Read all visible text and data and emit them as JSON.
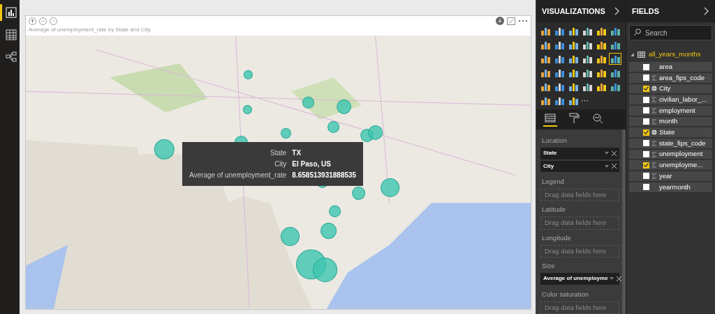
{
  "nav": [
    {
      "selected": true
    },
    {
      "selected": false
    },
    {
      "selected": false
    }
  ],
  "visual": {
    "title": "Average of unemployment_rate by State and City",
    "tooltip": [
      {
        "label": "State",
        "value": "TX"
      },
      {
        "label": "City",
        "value": "El Paso, US"
      },
      {
        "label": "Average of unemployment_rate",
        "value": "8.658513931888535"
      }
    ]
  },
  "visualizations": {
    "title": "VISUALIZATIONS",
    "types": [
      {
        "selected": false
      },
      {
        "selected": false
      },
      {
        "selected": false
      },
      {
        "selected": false
      },
      {
        "selected": false
      },
      {
        "selected": false
      },
      {
        "selected": false
      },
      {
        "selected": false
      },
      {
        "selected": false
      },
      {
        "selected": false
      },
      {
        "selected": false
      },
      {
        "selected": false
      },
      {
        "selected": false
      },
      {
        "selected": false
      },
      {
        "selected": false
      },
      {
        "selected": false
      },
      {
        "selected": false
      },
      {
        "selected": true
      },
      {
        "selected": false
      },
      {
        "selected": false
      },
      {
        "selected": false
      },
      {
        "selected": false
      },
      {
        "selected": false
      },
      {
        "selected": false
      },
      {
        "selected": false
      },
      {
        "selected": false
      },
      {
        "selected": false
      },
      {
        "selected": false
      },
      {
        "selected": false
      },
      {
        "selected": false
      },
      {
        "selected": false
      },
      {
        "selected": false
      },
      {
        "selected": false
      }
    ],
    "more": "···",
    "pane_tabs": [
      {
        "selected": true
      },
      {
        "selected": false
      },
      {
        "selected": false
      }
    ],
    "wells": [
      {
        "label": "Location",
        "fields": [
          "State",
          "City"
        ]
      },
      {
        "label": "Legend",
        "placeholder": "Drag data fields here"
      },
      {
        "label": "Latitude",
        "placeholder": "Drag data fields here"
      },
      {
        "label": "Longitude",
        "placeholder": "Drag data fields here"
      },
      {
        "label": "Size",
        "fields": [
          "Average of unemployme"
        ]
      },
      {
        "label": "Color saturation",
        "placeholder": "Drag data fields here"
      }
    ]
  },
  "fields": {
    "title": "FIELDS",
    "search": {
      "placeholder": "Search"
    },
    "table": "all_years_months",
    "items": [
      {
        "name": "area",
        "kind": "plain",
        "checked": false
      },
      {
        "name": "area_fips_code",
        "kind": "measure",
        "checked": false
      },
      {
        "name": "City",
        "kind": "geo",
        "checked": true
      },
      {
        "name": "civilian_labor_...",
        "kind": "measure",
        "checked": false
      },
      {
        "name": "employment",
        "kind": "measure",
        "checked": false
      },
      {
        "name": "month",
        "kind": "measure",
        "checked": false
      },
      {
        "name": "State",
        "kind": "geo",
        "checked": true
      },
      {
        "name": "state_fips_code",
        "kind": "measure",
        "checked": false
      },
      {
        "name": "unemployment",
        "kind": "measure",
        "checked": false
      },
      {
        "name": "unemployme...",
        "kind": "measure",
        "checked": true
      },
      {
        "name": "year",
        "kind": "measure",
        "checked": false
      },
      {
        "name": "yearmonth",
        "kind": "plain",
        "checked": false
      }
    ]
  }
}
